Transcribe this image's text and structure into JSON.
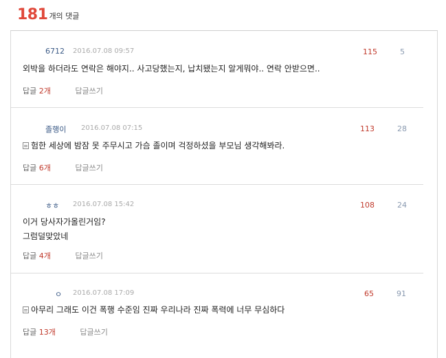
{
  "header": {
    "count": "181",
    "suffix": "개의 댓글"
  },
  "comments": [
    {
      "author": "6712",
      "date": "2016.07.08 09:57",
      "likes": "115",
      "dislikes": "5",
      "memo": false,
      "lines": [
        "외박을 하더라도 연락은 해야지.. 사고당했는지, 납치됐는지 알게뭐야.. 연락 안받으면.."
      ],
      "reply_label": "답글",
      "reply_count": "2개",
      "write_label": "답글쓰기"
    },
    {
      "author": "졸행이",
      "date": "2016.07.08 07:15",
      "likes": "113",
      "dislikes": "28",
      "memo": true,
      "lines": [
        "험한 세상에 밤잠 못 주무시고 가슴 졸이며 걱정하셨을 부모님 생각해봐라."
      ],
      "reply_label": "답글",
      "reply_count": "6개",
      "write_label": "답글쓰기"
    },
    {
      "author": "ㅎㅎ",
      "date": "2016.07.08 15:42",
      "likes": "108",
      "dislikes": "24",
      "memo": false,
      "lines": [
        "이거 당사자가올린거임?",
        "그럼덜맞았네"
      ],
      "reply_label": "답글",
      "reply_count": "4개",
      "write_label": "답글쓰기"
    },
    {
      "author": "ㅇ",
      "date": "2016.07.08 17:09",
      "likes": "65",
      "dislikes": "91",
      "memo": true,
      "lines": [
        "아무리 그래도 이건 폭행 수준임 진짜 우리나라 진짜 폭력에 너무 무심하다"
      ],
      "reply_label": "답글",
      "reply_count": "13개",
      "write_label": "답글쓰기"
    }
  ]
}
